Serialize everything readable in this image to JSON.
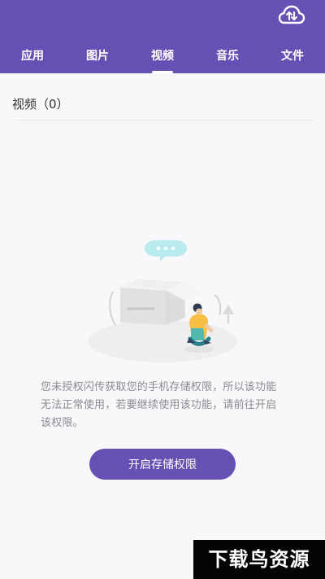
{
  "header": {
    "background": "#6750b4",
    "cloud_icon": "cloud-transfer-icon"
  },
  "tabs": [
    {
      "label": "应用",
      "selected": false
    },
    {
      "label": "图片",
      "selected": false
    },
    {
      "label": "视频",
      "selected": true
    },
    {
      "label": "音乐",
      "selected": false
    },
    {
      "label": "文件",
      "selected": false
    }
  ],
  "content": {
    "section_title": "视频（0）",
    "empty_message": "您未授权闪传获取您的手机存储权限，所以该功能无法正常使用，若要继续使用该功能，请前往开启该权限。",
    "button_label": "开启存储权限",
    "illustration_icon": "empty-box-person-illustration"
  },
  "watermark": {
    "text": "下载鸟资源"
  }
}
